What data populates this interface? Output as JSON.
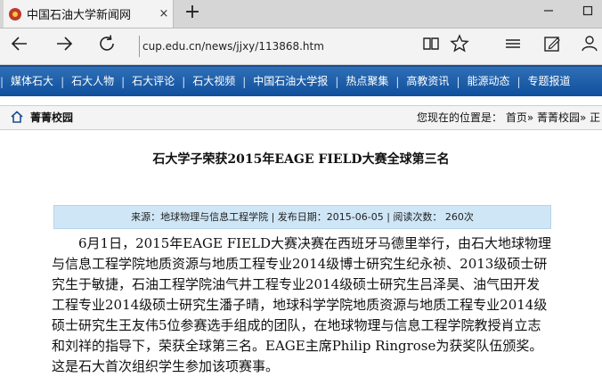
{
  "browser": {
    "tab_title": "中国石油大学新闻网",
    "tab_close": "×",
    "new_tab": "+",
    "url": "cup.edu.cn/news/jjxy/113868.htm"
  },
  "menu": {
    "items": [
      "媒体石大",
      "石大人物",
      "石大评论",
      "石大视频",
      "中国石油大学报",
      "热点聚集",
      "高教资讯",
      "能源动态",
      "专题报道"
    ],
    "separator": "|"
  },
  "breadcrumb": {
    "section": "菁菁校园",
    "location": "您现在的位置是： 首页» 菁菁校园» 正"
  },
  "article": {
    "title": "石大学子荣获2015年EAGE FIELD大赛全球第三名",
    "meta": "来源：地球物理与信息工程学院 | 发布日期：2015-06-05 | 阅读次数：  260次",
    "body": "6月1日，2015年EAGE FIELD大赛决赛在西班牙马德里举行，由石大地球物理与信息工程学院地质资源与地质工程专业2014级博士研究生纪永祯、2013级硕士研究生于敏捷，石油工程学院油气井工程专业2014级硕士研究生吕泽昊、油气田开发工程专业2014级硕士研究生潘子晴，地球科学学院地质资源与地质工程专业2014级硕士研究生王友伟5位参赛选手组成的团队，在地球物理与信息工程学院教授肖立志和刘祥的指导下，荣获全球第三名。EAGE主席Philip Ringrose为获奖队伍颁奖。这是石大首次组织学生参加该项赛事。"
  },
  "colors": {
    "menu_bar": "#1a5aa6",
    "meta_bg": "#cfe6f7"
  }
}
